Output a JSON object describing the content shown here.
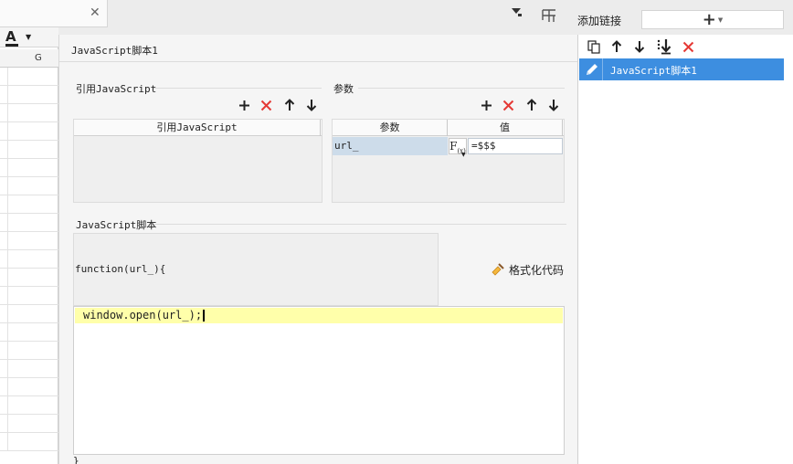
{
  "spreadsheet": {
    "column_letter": "G",
    "font_color_glyph": "A"
  },
  "dialog": {
    "title": "JavaScript脚本1",
    "referenced_js": {
      "section_title": "引用JavaScript",
      "column_header": "引用JavaScript",
      "rows": []
    },
    "parameters": {
      "section_title": "参数",
      "columns": [
        "参数",
        "值"
      ],
      "rows": [
        {
          "name": "url_",
          "value": "=$$$"
        }
      ]
    },
    "script": {
      "section_title": "JavaScript脚本",
      "function_signature": "function(url_){",
      "code": "window.open(url_);",
      "closing": "}",
      "format_button_label": "格式化代码"
    }
  },
  "right_panel": {
    "add_link_label": "添加链接",
    "items": [
      {
        "label": "JavaScript脚本1",
        "selected": true
      }
    ]
  },
  "colors": {
    "accent": "#3d8ee0",
    "delete_red": "#e53935",
    "code_highlight": "#ffffaa",
    "selected_param": "#cddcea"
  }
}
